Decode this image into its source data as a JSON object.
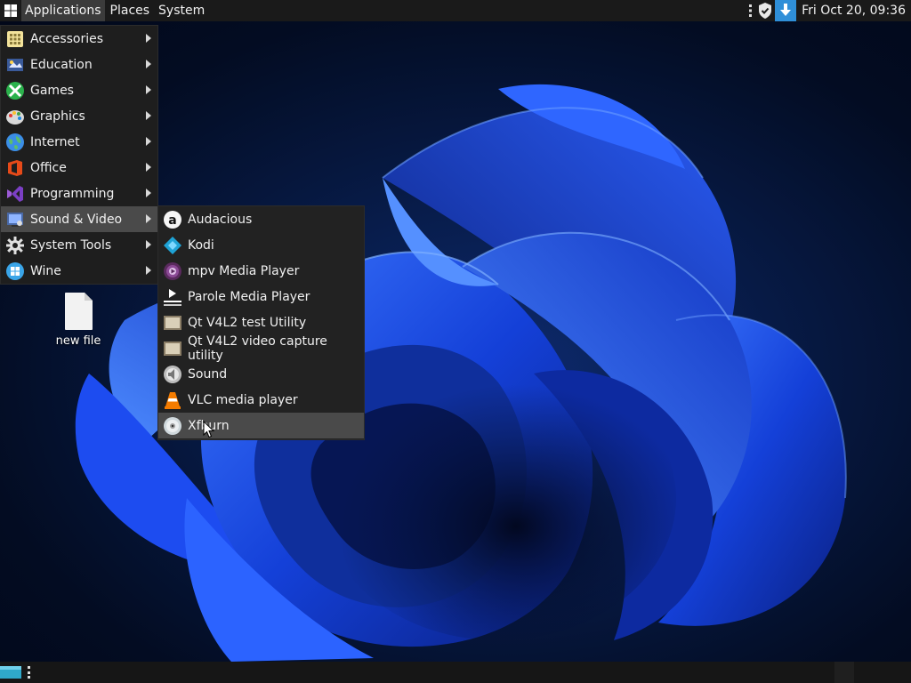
{
  "top_panel": {
    "applications_label": "Applications",
    "places_label": "Places",
    "system_label": "System",
    "clock": "Fri Oct 20, 09:36"
  },
  "main_menu": {
    "items": [
      {
        "label": "Accessories",
        "icon": "accessories-icon"
      },
      {
        "label": "Education",
        "icon": "education-icon"
      },
      {
        "label": "Games",
        "icon": "games-icon"
      },
      {
        "label": "Graphics",
        "icon": "graphics-icon"
      },
      {
        "label": "Internet",
        "icon": "internet-icon"
      },
      {
        "label": "Office",
        "icon": "office-icon"
      },
      {
        "label": "Programming",
        "icon": "programming-icon"
      },
      {
        "label": "Sound & Video",
        "icon": "sound-video-icon",
        "selected": true
      },
      {
        "label": "System Tools",
        "icon": "system-tools-icon"
      },
      {
        "label": "Wine",
        "icon": "wine-icon"
      }
    ]
  },
  "sub_menu": {
    "items": [
      {
        "label": "Audacious",
        "icon": "audacious-icon"
      },
      {
        "label": "Kodi",
        "icon": "kodi-icon"
      },
      {
        "label": "mpv Media Player",
        "icon": "mpv-icon"
      },
      {
        "label": "Parole Media Player",
        "icon": "parole-icon"
      },
      {
        "label": "Qt V4L2 test Utility",
        "icon": "qv4l2-icon"
      },
      {
        "label": "Qt V4L2 video capture utility",
        "icon": "qvidcap-icon"
      },
      {
        "label": "Sound",
        "icon": "sound-icon"
      },
      {
        "label": "VLC media player",
        "icon": "vlc-icon"
      },
      {
        "label": "Xfburn",
        "icon": "xfburn-icon",
        "selected": true
      }
    ]
  },
  "desktop": {
    "icons": [
      {
        "label": "new file",
        "icon": "file-icon"
      }
    ]
  },
  "colors": {
    "panel": "#1a1a1a",
    "menu_bg": "#1e1e1e",
    "selected": "#4a4a4a",
    "wallpaper_accent": "#1f4dff"
  }
}
